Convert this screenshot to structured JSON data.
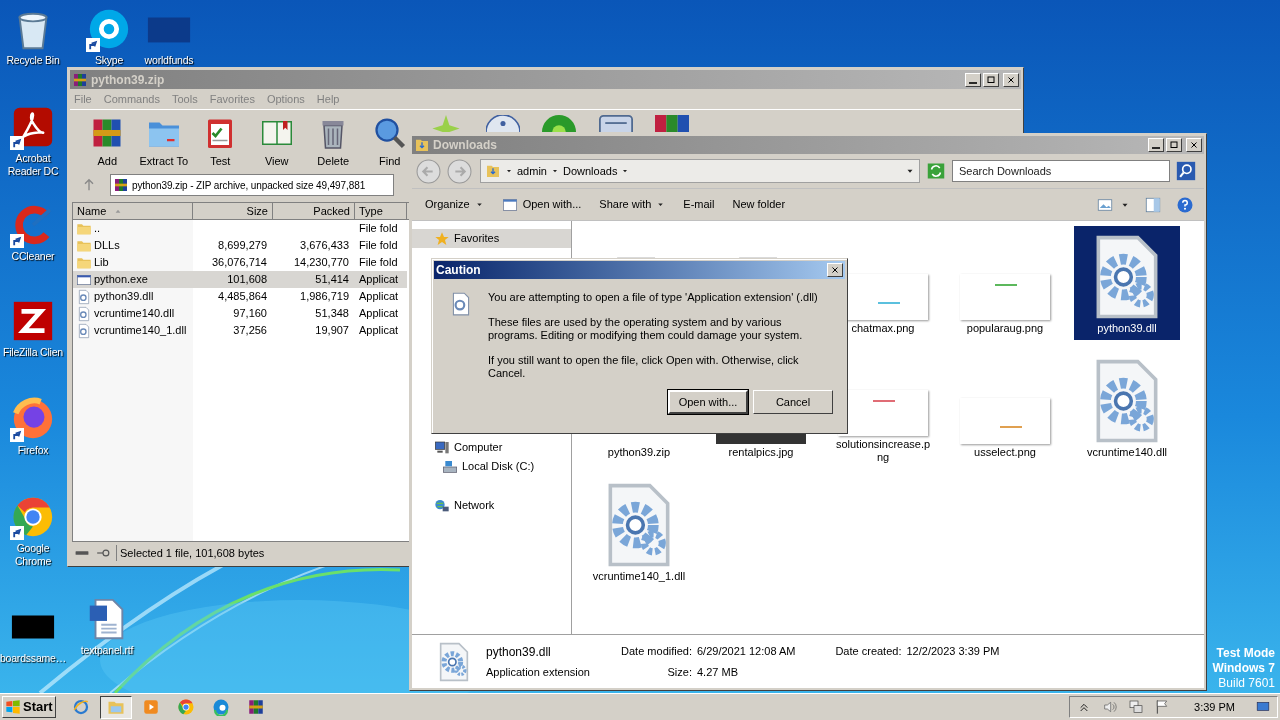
{
  "desktop_icons": [
    {
      "label": "Recycle Bin",
      "kind": "recycle",
      "shortcut": false
    },
    {
      "label": "Skype",
      "kind": "skype",
      "shortcut": true
    },
    {
      "label": "worldfunds",
      "kind": "darkthumb",
      "shortcut": false
    },
    {
      "label": "Acrobat Reader DC",
      "kind": "acrobat",
      "shortcut": true
    },
    {
      "label": "CCleaner",
      "kind": "ccleaner",
      "shortcut": true
    },
    {
      "label": "FileZilla Clien",
      "kind": "filezilla",
      "shortcut": false
    },
    {
      "label": "Firefox",
      "kind": "firefox",
      "shortcut": true
    },
    {
      "label": "Google Chrome",
      "kind": "chrome",
      "shortcut": true
    },
    {
      "label": "boardssame…",
      "kind": "blackthumb",
      "shortcut": false
    },
    {
      "label": "textpanel.rtf",
      "kind": "word",
      "shortcut": false
    }
  ],
  "winrar": {
    "title": "python39.zip",
    "menu": [
      "File",
      "Commands",
      "Tools",
      "Favorites",
      "Options",
      "Help"
    ],
    "tools": [
      {
        "label": "Add",
        "kind": "add"
      },
      {
        "label": "Extract To",
        "kind": "extract"
      },
      {
        "label": "Test",
        "kind": "test"
      },
      {
        "label": "View",
        "kind": "view"
      },
      {
        "label": "Delete",
        "kind": "delete"
      },
      {
        "label": "Find",
        "kind": "find"
      },
      {
        "kind": "wizard"
      },
      {
        "kind": "info"
      },
      {
        "kind": "scan"
      },
      {
        "kind": "comment"
      },
      {
        "kind": "sfx"
      }
    ],
    "address": "python39.zip - ZIP archive, unpacked size 49,497,881",
    "columns": [
      {
        "label": "Name",
        "sorted": true
      },
      {
        "label": "Size",
        "sorted": false
      },
      {
        "label": "Packed",
        "sorted": false
      },
      {
        "label": "Type",
        "sorted": false
      }
    ],
    "rows": [
      {
        "name": "..",
        "type": "File fold",
        "kind": "folder",
        "selected": false
      },
      {
        "name": "DLLs",
        "size": "8,699,279",
        "packed": "3,676,433",
        "type": "File fold",
        "kind": "folder",
        "selected": false
      },
      {
        "name": "Lib",
        "size": "36,076,714",
        "packed": "14,230,770",
        "type": "File fold",
        "kind": "folder",
        "selected": false
      },
      {
        "name": "python.exe",
        "size": "101,608",
        "packed": "51,414",
        "type": "Applicat",
        "kind": "exe",
        "selected": true
      },
      {
        "name": "python39.dll",
        "size": "4,485,864",
        "packed": "1,986,719",
        "type": "Applicat",
        "kind": "dll",
        "selected": false
      },
      {
        "name": "vcruntime140.dll",
        "size": "97,160",
        "packed": "51,348",
        "type": "Applicat",
        "kind": "dll",
        "selected": false
      },
      {
        "name": "vcruntime140_1.dll",
        "size": "37,256",
        "packed": "19,907",
        "type": "Applicat",
        "kind": "dll",
        "selected": false
      }
    ],
    "status": "Selected 1 file, 101,608 bytes"
  },
  "explorer": {
    "title": "Downloads",
    "breadcrumb": [
      "admin",
      "Downloads"
    ],
    "search_placeholder": "Search Downloads",
    "commands": [
      {
        "label": "Organize",
        "dropdown": true,
        "kind": "text"
      },
      {
        "label": "Open with...",
        "dropdown": false,
        "kind": "openwith"
      },
      {
        "label": "Share with",
        "dropdown": true,
        "kind": "text"
      },
      {
        "label": "E-mail",
        "dropdown": false,
        "kind": "text"
      },
      {
        "label": "New folder",
        "dropdown": false,
        "kind": "text"
      }
    ],
    "sidebar": [
      {
        "label": "Favorites",
        "kind": "star",
        "selected": true
      },
      {
        "label": "Computer",
        "kind": "computer",
        "selected": false,
        "children": [
          {
            "label": "Local Disk (C:)",
            "kind": "disk",
            "selected": false
          }
        ]
      },
      {
        "label": "Network",
        "kind": "network",
        "selected": false
      }
    ],
    "items": [
      {
        "kind": "folder",
        "selected": false
      },
      {
        "kind": "folder",
        "selected": false
      },
      {
        "label": "chatmax.png",
        "color": "#5bc0de",
        "selected": false
      },
      {
        "label": "popularaug.png",
        "color": "#5cb85c",
        "selected": false
      },
      {
        "label": "python39.dll",
        "kind": "dll",
        "selected": true
      },
      {
        "label": "python39.zip",
        "kind": "hidden",
        "selected": false
      },
      {
        "label": "rentalpics.jpg",
        "kind": "darkimage",
        "selected": false
      },
      {
        "label": "solutionsincrease.png",
        "color": "#e06c75",
        "selected": false
      },
      {
        "label": "usselect.png",
        "color": "#e0a050",
        "selected": false
      },
      {
        "label": "vcruntime140.dll",
        "kind": "dll",
        "selected": false
      },
      {
        "label": "vcruntime140_1.dll",
        "kind": "dll",
        "selected": false
      }
    ],
    "details": {
      "name": "python39.dll",
      "type": "Application extension",
      "fields": [
        {
          "label": "Date modified:",
          "value": "6/29/2021 12:08 AM"
        },
        {
          "label": "Size:",
          "value": "4.27 MB"
        },
        {
          "label": "Date created:",
          "value": "12/2/2023 3:39 PM"
        }
      ]
    }
  },
  "dialog": {
    "title": "Caution",
    "paragraphs": [
      "You are attempting to open a file of type 'Application extension' (.dll)",
      "These files are used by the operating system and by various programs. Editing or modifying them could damage your system.",
      "If you still want to open the file, click Open with. Otherwise, click Cancel."
    ],
    "buttons": [
      {
        "label": "Open with...",
        "default": true
      },
      {
        "label": "Cancel",
        "default": false
      }
    ]
  },
  "os_notice": [
    "Test Mode",
    "Windows 7",
    "Build 7601"
  ],
  "taskbar": {
    "start": "Start",
    "apps": [
      {
        "kind": "ie",
        "active": false
      },
      {
        "kind": "explorer",
        "active": true
      },
      {
        "kind": "media",
        "active": false
      },
      {
        "kind": "chrome",
        "active": false
      },
      {
        "kind": "edge",
        "active": false
      },
      {
        "kind": "rar",
        "active": false
      }
    ],
    "clock": "3:39 PM"
  }
}
